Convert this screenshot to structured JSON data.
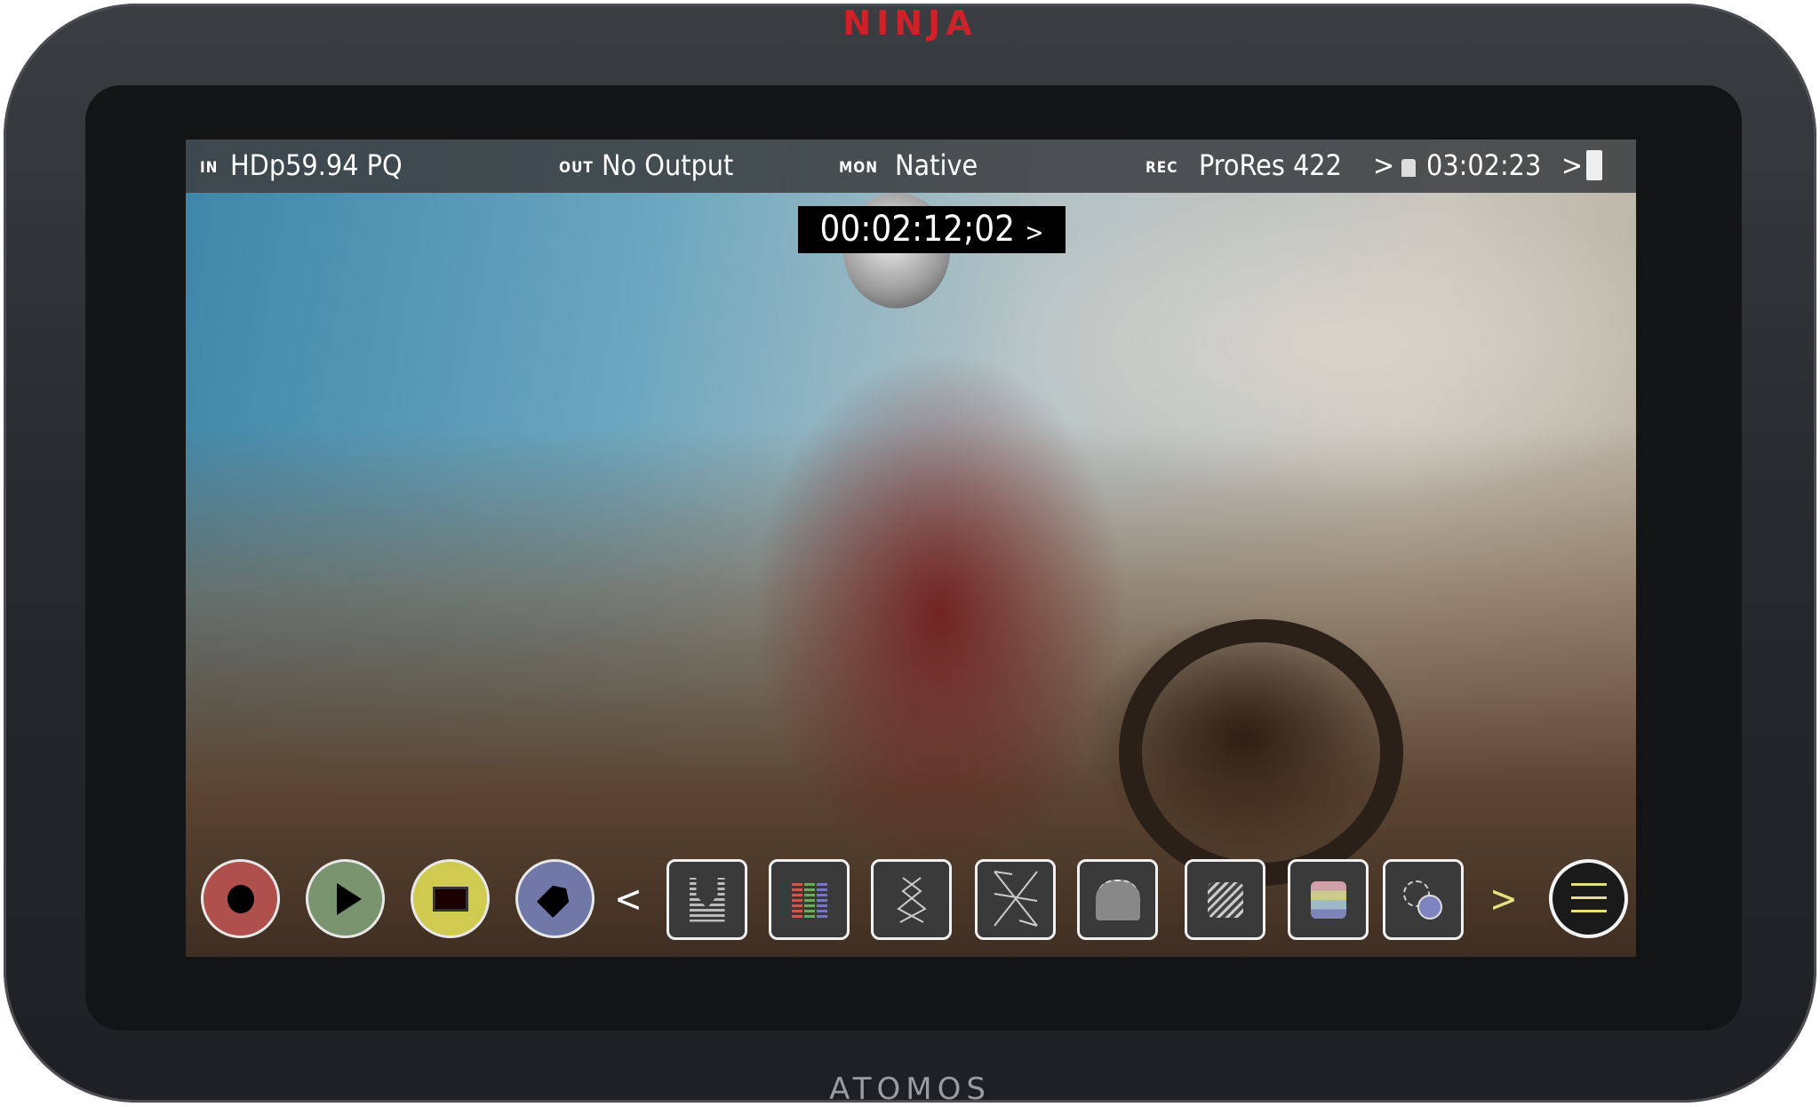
{
  "device": {
    "brand_top": "NINJA",
    "brand_bottom": "ATOMOS"
  },
  "status_bar": {
    "in_label": "IN",
    "in_value": "HDp59.94 PQ",
    "out_label": "OUT",
    "out_value": "No Output",
    "mon_label": "MON",
    "mon_value": "Native",
    "rec_label": "REC",
    "rec_value": "ProRes 422",
    "chevron": ">",
    "remaining_time": "03:02:23"
  },
  "timecode": {
    "value": "00:02:12;02",
    "chevron": ">"
  },
  "controls": {
    "chevron_left": "<",
    "chevron_right": ">",
    "colors": {
      "record": "#b0504c",
      "play": "#7a9470",
      "stop": "#cfcb50",
      "tag": "#7078a8",
      "accent": "#e6e080"
    }
  },
  "tools": [
    "waveform-icon",
    "vectorscope-rgb-parade-icon",
    "focus-peaking-icon",
    "zebra-cross-icon",
    "false-color-person-icon",
    "zebra-stripes-icon",
    "color-bars-icon",
    "luts-icon"
  ]
}
